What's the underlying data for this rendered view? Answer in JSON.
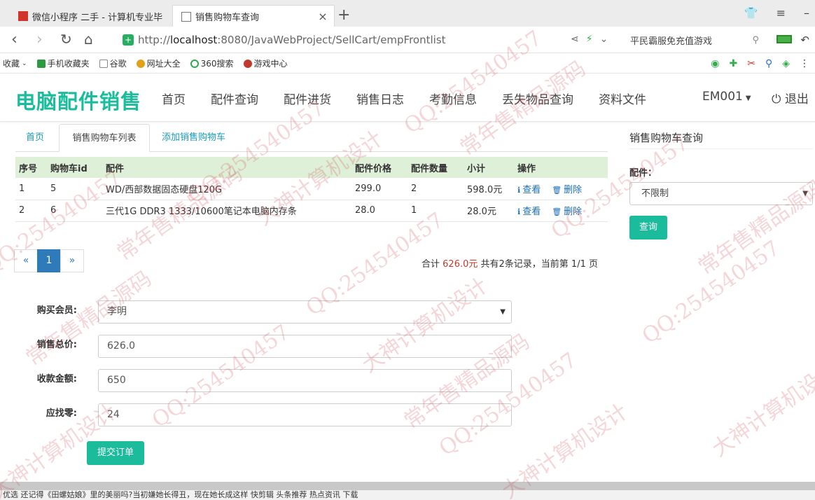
{
  "browser": {
    "tabs": [
      {
        "title": "微信小程序 二手 - 计算机专业毕"
      },
      {
        "title": "销售购物车查询"
      }
    ],
    "new_tab": "+",
    "url_scheme": "http://",
    "url_host": "localhost",
    "url_rest": ":8080/JavaWebProject/SellCart/empFrontlist",
    "search_text": "平民霸服免充值游戏",
    "bookmarks": [
      "收藏",
      "手机收藏夹",
      "谷歌",
      "网址大全",
      "360搜索",
      "游戏中心"
    ]
  },
  "app": {
    "brand": "电脑配件销售",
    "menu": [
      "首页",
      "配件查询",
      "配件进货",
      "销售日志",
      "考勤信息",
      "丢失物品查询",
      "资料文件"
    ],
    "user": "EM001",
    "logout": "退出"
  },
  "tabs": [
    "首页",
    "销售购物车列表",
    "添加销售购物车"
  ],
  "table": {
    "headers": [
      "序号",
      "购物车id",
      "配件",
      "配件价格",
      "配件数量",
      "小计",
      "操作"
    ],
    "rows": [
      {
        "seq": "1",
        "id": "5",
        "part": "WD/西部数据固态硬盘120G",
        "price": "299.0",
        "qty": "2",
        "subtotal": "598.0元"
      },
      {
        "seq": "2",
        "id": "6",
        "part": "三代1G DDR3 1333/10600笔记本电脑内存条",
        "price": "28.0",
        "qty": "1",
        "subtotal": "28.0元"
      }
    ],
    "view_label": "查看",
    "delete_label": "删除"
  },
  "pager": {
    "prev": "«",
    "current": "1",
    "next": "»"
  },
  "summary": {
    "prefix": "合计",
    "amount": "626.0元",
    "suffix": "共有2条记录，当前第 1/1 页"
  },
  "form": {
    "member_label": "购买会员:",
    "member_value": "李明",
    "total_label": "销售总价:",
    "total_value": "626.0",
    "received_label": "收款金额:",
    "received_value": "650",
    "change_label": "应找零:",
    "change_value": "24",
    "submit": "提交订单"
  },
  "sidebar": {
    "title": "销售购物车查询",
    "part_label": "配件：",
    "part_value": "不限制",
    "query": "查询"
  },
  "statusbar": "优选    还记得《田螺姑娘》里的美丽吗?当初嫌她长得丑，现在她长成这样          快剪辑     头条推荐     热点资讯                    下载",
  "watermark": [
    "QQ:254540457",
    "常年售精品源码",
    "大神计算机设计"
  ],
  "colors": {
    "accent": "#1abc9c",
    "table_header": "#dff0d8",
    "link": "#1a6fb8",
    "pager_active": "#2f7ab8"
  }
}
